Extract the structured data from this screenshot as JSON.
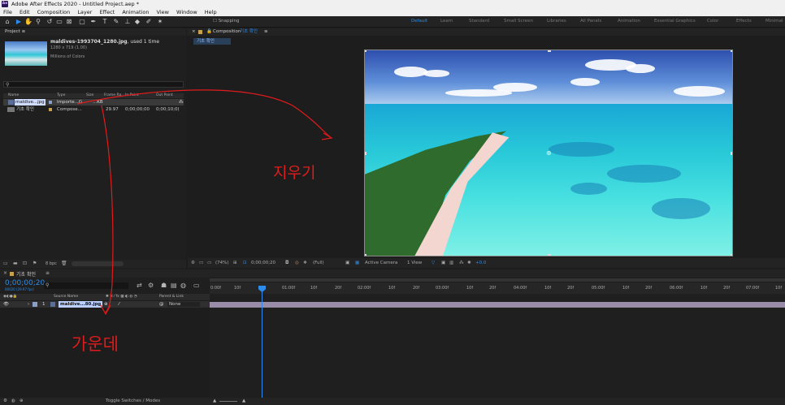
{
  "window": {
    "app_badge": "Ae",
    "title": "Adobe After Effects 2020 - Untitled Project.aep *"
  },
  "menu": [
    "File",
    "Edit",
    "Composition",
    "Layer",
    "Effect",
    "Animation",
    "View",
    "Window",
    "Help"
  ],
  "toolbar": {
    "snapping_label": "Snapping",
    "workspaces": [
      "Default",
      "Learn",
      "Standard",
      "Small Screen",
      "Libraries",
      "All Panels",
      "Animation",
      "Essential Graphics",
      "Color",
      "Effects",
      "Minimal"
    ]
  },
  "project": {
    "tab": "Project",
    "asset_name": "maldives-1993704_1280.jpg",
    "asset_used": ", used 1 time",
    "asset_dims": "1280 x 719 (1.00)",
    "asset_colors": "Millions of Colors",
    "search_icon": "search-icon",
    "columns": [
      "Name",
      "Type",
      "Size",
      "Frame Ra...",
      "In Point",
      "Out Point"
    ],
    "rows": [
      {
        "name": "maldive...jpg",
        "type": "Importe...G",
        "size": "...KB",
        "rate": "",
        "in": "",
        "out": ""
      },
      {
        "name": "기초 확인",
        "type": "Compose...",
        "size": "",
        "rate": "29.97",
        "in": "0;00;00;00",
        "out": "0;00;10;0("
      }
    ],
    "footer_bpc": "8 bpc"
  },
  "composition": {
    "tab_prefix": "Composition",
    "tab_name": "기초 확인",
    "sub_tab": "기초 확인",
    "viewer": {
      "zoom": "(74%)",
      "timecode": "0;00;00;20",
      "resolution": "(Full)",
      "camera": "Active Camera",
      "views": "1 View",
      "exposure": "+0.0"
    }
  },
  "timeline": {
    "tab": "기초 확인",
    "timecode": "0;00;00;20",
    "frame_info": "00020 (29.97 fps)",
    "col_source": "Source Name",
    "col_parent": "Parent & Link",
    "layer": {
      "num": "1",
      "name": "maldive...80.jpg",
      "parent": "None"
    },
    "ruler": [
      "0:00f",
      "10f",
      "20f",
      "01:00f",
      "10f",
      "20f",
      "02:00f",
      "10f",
      "20f",
      "03:00f",
      "10f",
      "20f",
      "04:00f",
      "10f",
      "20f",
      "05:00f",
      "10f",
      "20f",
      "06:00f",
      "10f",
      "20f",
      "07:00f",
      "10f"
    ],
    "toggle_label": "Toggle Switches / Modes"
  },
  "annotations": {
    "middle": "지우기",
    "bottom": "가운데"
  },
  "colors": {
    "accent": "#2d8ceb",
    "annotation": "#e01b1b",
    "layer_bar": "#b6a7cc"
  }
}
